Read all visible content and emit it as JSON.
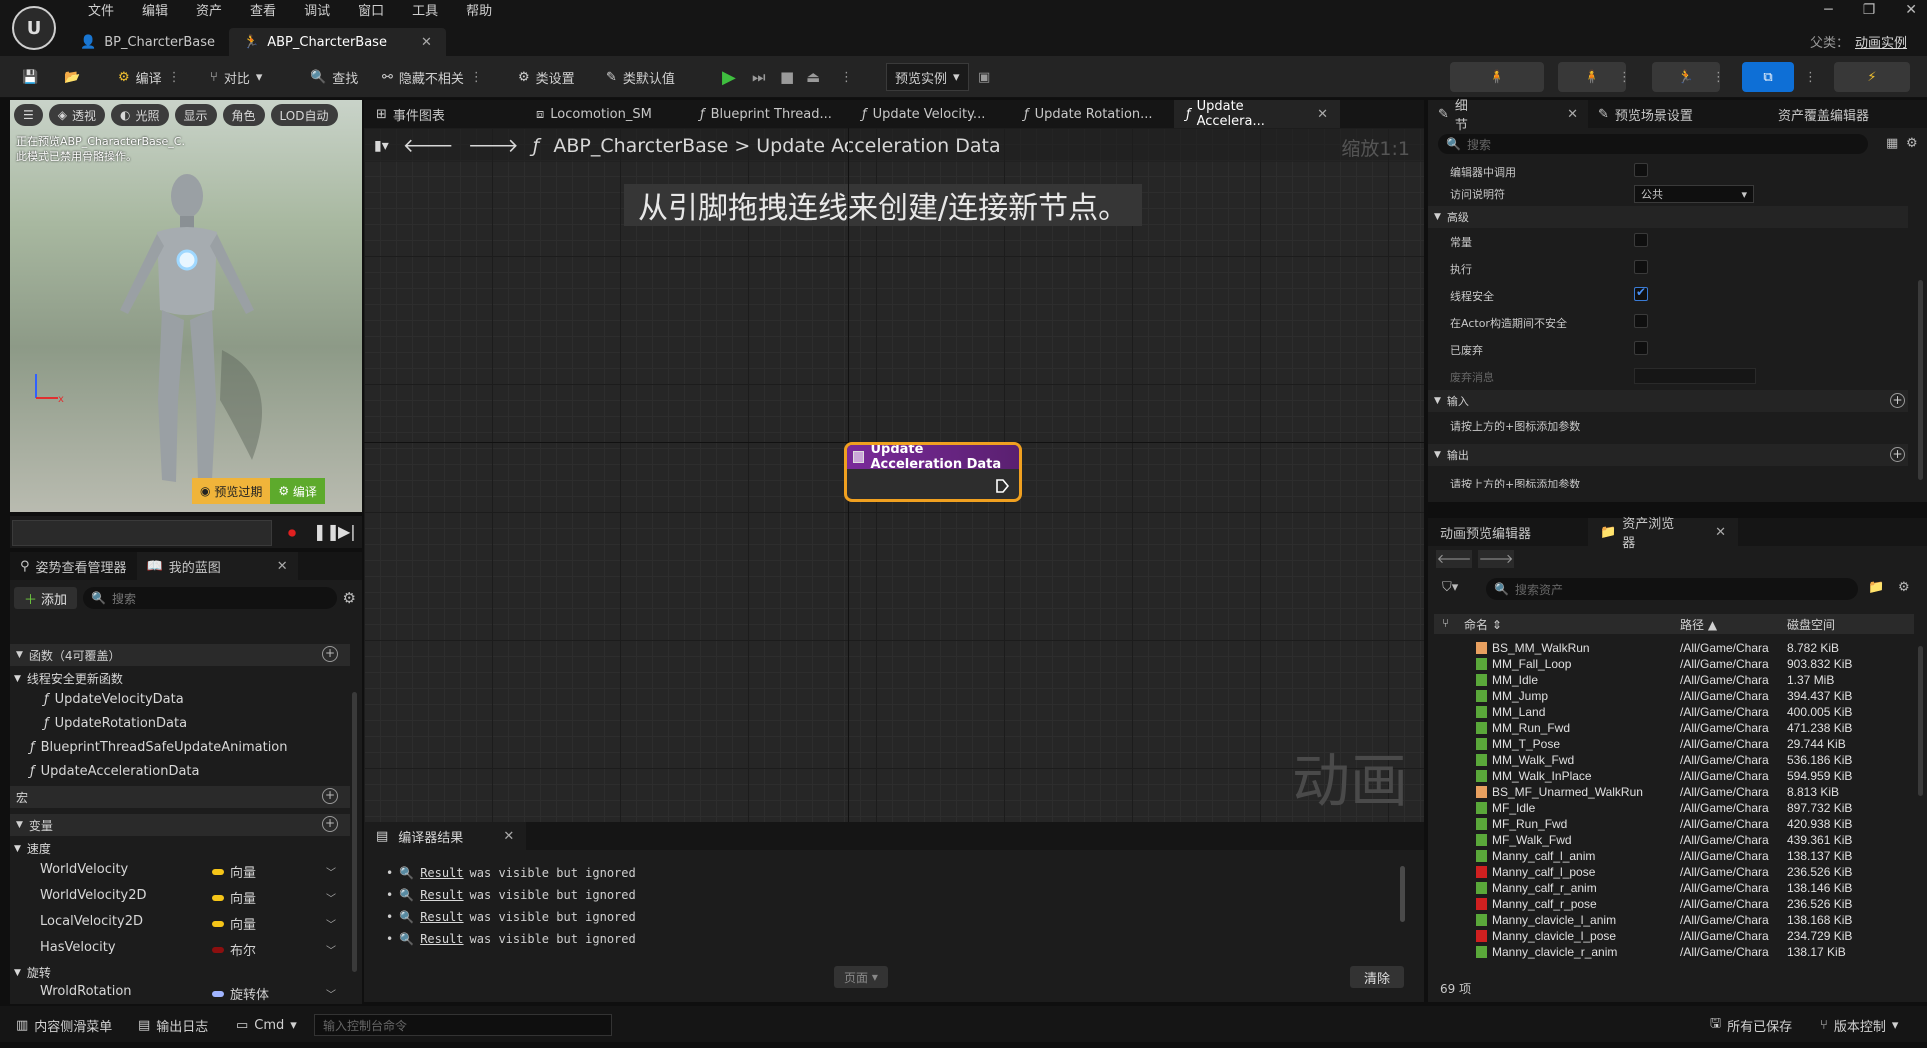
{
  "app": {
    "menu": [
      "文件",
      "编辑",
      "资产",
      "查看",
      "调试",
      "窗口",
      "工具",
      "帮助"
    ],
    "doc_tabs": [
      {
        "label": "BP_CharcterBase",
        "active": false
      },
      {
        "label": "ABP_CharcterBase",
        "active": true
      }
    ],
    "parent_class_label": "父类：",
    "parent_class_value": "动画实例"
  },
  "toolbar": {
    "compile": "编译",
    "diff": "对比",
    "find": "查找",
    "hide_unrelated": "隐藏不相关",
    "class_settings": "类设置",
    "class_defaults": "类默认值",
    "preview_instance": "预览实例"
  },
  "viewport": {
    "buttons": [
      "透视",
      "光照",
      "显示",
      "角色",
      "LOD自动"
    ],
    "message_line1": "正在预览ABP_CharacterBase_C.",
    "message_line2": "此模式已禁用骨骼操作。",
    "preview_expired": "预览过期",
    "compile_btn": "编译"
  },
  "left_panel": {
    "tabs": [
      "姿势查看管理器",
      "我的蓝图"
    ],
    "add": "添加",
    "search_placeholder": "搜索",
    "functions_header": "函数（4可覆盖）",
    "thread_safe_group": "线程安全更新函数",
    "functions": [
      "UpdateVelocityData",
      "UpdateRotationData",
      "BlueprintThreadSafeUpdateAnimation",
      "UpdateAccelerationData"
    ],
    "macros_header": "宏",
    "variables_header": "变量",
    "velocity_group": "速度",
    "variables": [
      {
        "name": "WorldVelocity",
        "type": "向量",
        "color": "#f5c518"
      },
      {
        "name": "WorldVelocity2D",
        "type": "向量",
        "color": "#f5c518"
      },
      {
        "name": "LocalVelocity2D",
        "type": "向量",
        "color": "#f5c518"
      },
      {
        "name": "HasVelocity",
        "type": "布尔",
        "color": "#8c0f0f"
      }
    ],
    "rotation_group": "旋转",
    "rotation_var": {
      "name": "WroldRotation",
      "type": "旋转体",
      "color": "#a0b4ff"
    }
  },
  "graph": {
    "tabs": [
      {
        "label": "事件图表",
        "active": false
      },
      {
        "label": "Locomotion_SM",
        "active": false
      },
      {
        "label": "Blueprint Thread...",
        "active": false
      },
      {
        "label": "Update Velocity...",
        "active": false
      },
      {
        "label": "Update Rotation...",
        "active": false
      },
      {
        "label": "Update Accelera...",
        "active": true
      }
    ],
    "breadcrumb_root": "ABP_CharcterBase",
    "breadcrumb_sep": ">",
    "breadcrumb_leaf": "Update Acceleration Data",
    "zoom": "缩放1:1",
    "hint": "从引脚拖拽连线来创建/连接新节点。",
    "watermark": "动画",
    "node_title": "Update Acceleration Data"
  },
  "compiler": {
    "tab": "编译器结果",
    "lines": [
      {
        "link": "Result",
        "text": "was visible but ignored"
      },
      {
        "link": "Result",
        "text": "was visible but ignored"
      },
      {
        "link": "Result",
        "text": "was visible but ignored"
      },
      {
        "link": "Result",
        "text": "was visible but ignored"
      }
    ],
    "page": "页面",
    "clear": "清除"
  },
  "details": {
    "tabs": [
      "细节",
      "预览场景设置",
      "资产覆盖编辑器"
    ],
    "search_placeholder": "搜索",
    "rows": [
      {
        "label": "编辑器中调用",
        "kind": "check",
        "checked": false
      },
      {
        "label": "访问说明符",
        "kind": "select",
        "value": "公共"
      }
    ],
    "advanced_header": "高级",
    "advanced_rows": [
      {
        "label": "常量",
        "checked": false
      },
      {
        "label": "执行",
        "checked": false
      },
      {
        "label": "线程安全",
        "checked": true
      },
      {
        "label": "在Actor构造期间不安全",
        "checked": false
      },
      {
        "label": "已废弃",
        "checked": false
      }
    ],
    "deprecation_msg": "废弃消息",
    "inputs_header": "输入",
    "inputs_hint": "请按上方的+图标添加参数",
    "outputs_header": "输出",
    "outputs_hint": "请按上方的+图标添加参数"
  },
  "assets": {
    "tabs": [
      "动画预览编辑器",
      "资产浏览器"
    ],
    "search_placeholder": "搜索资产",
    "col_name": "命名",
    "col_path": "路径",
    "col_size": "磁盘空间",
    "rows": [
      {
        "name": "BS_MM_WalkRun",
        "path": "/All/Game/Chara",
        "size": "8.782 KiB",
        "color": "#e8a060"
      },
      {
        "name": "MM_Fall_Loop",
        "path": "/All/Game/Chara",
        "size": "903.832 KiB",
        "color": "#5aa83a"
      },
      {
        "name": "MM_Idle",
        "path": "/All/Game/Chara",
        "size": "1.37 MiB",
        "color": "#5aa83a"
      },
      {
        "name": "MM_Jump",
        "path": "/All/Game/Chara",
        "size": "394.437 KiB",
        "color": "#5aa83a"
      },
      {
        "name": "MM_Land",
        "path": "/All/Game/Chara",
        "size": "400.005 KiB",
        "color": "#5aa83a"
      },
      {
        "name": "MM_Run_Fwd",
        "path": "/All/Game/Chara",
        "size": "471.238 KiB",
        "color": "#5aa83a"
      },
      {
        "name": "MM_T_Pose",
        "path": "/All/Game/Chara",
        "size": "29.744 KiB",
        "color": "#5aa83a"
      },
      {
        "name": "MM_Walk_Fwd",
        "path": "/All/Game/Chara",
        "size": "536.186 KiB",
        "color": "#5aa83a"
      },
      {
        "name": "MM_Walk_InPlace",
        "path": "/All/Game/Chara",
        "size": "594.959 KiB",
        "color": "#5aa83a"
      },
      {
        "name": "BS_MF_Unarmed_WalkRun",
        "path": "/All/Game/Chara",
        "size": "8.813 KiB",
        "color": "#e8a060"
      },
      {
        "name": "MF_Idle",
        "path": "/All/Game/Chara",
        "size": "897.732 KiB",
        "color": "#5aa83a"
      },
      {
        "name": "MF_Run_Fwd",
        "path": "/All/Game/Chara",
        "size": "420.938 KiB",
        "color": "#5aa83a"
      },
      {
        "name": "MF_Walk_Fwd",
        "path": "/All/Game/Chara",
        "size": "439.361 KiB",
        "color": "#5aa83a"
      },
      {
        "name": "Manny_calf_l_anim",
        "path": "/All/Game/Chara",
        "size": "138.137 KiB",
        "color": "#5aa83a"
      },
      {
        "name": "Manny_calf_l_pose",
        "path": "/All/Game/Chara",
        "size": "236.526 KiB",
        "color": "#d02020"
      },
      {
        "name": "Manny_calf_r_anim",
        "path": "/All/Game/Chara",
        "size": "138.146 KiB",
        "color": "#5aa83a"
      },
      {
        "name": "Manny_calf_r_pose",
        "path": "/All/Game/Chara",
        "size": "236.526 KiB",
        "color": "#d02020"
      },
      {
        "name": "Manny_clavicle_l_anim",
        "path": "/All/Game/Chara",
        "size": "138.168 KiB",
        "color": "#5aa83a"
      },
      {
        "name": "Manny_clavicle_l_pose",
        "path": "/All/Game/Chara",
        "size": "234.729 KiB",
        "color": "#d02020"
      },
      {
        "name": "Manny_clavicle_r_anim",
        "path": "/All/Game/Chara",
        "size": "138.17 KiB",
        "color": "#5aa83a"
      }
    ],
    "count": "69 项"
  },
  "statusbar": {
    "content_drawer": "内容侧滑菜单",
    "output_log": "输出日志",
    "cmd": "Cmd",
    "cmd_placeholder": "输入控制台命令",
    "all_saved": "所有已保存",
    "source_control": "版本控制"
  }
}
